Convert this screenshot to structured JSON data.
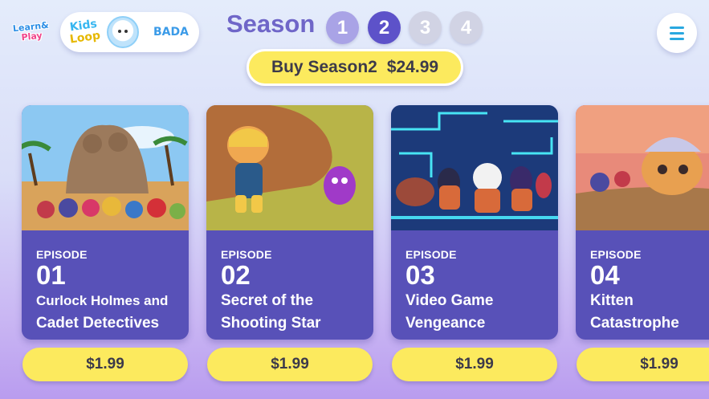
{
  "logo": {
    "line1": "Learn&",
    "line2": "Play"
  },
  "profile": {
    "brand_line1": "Kids",
    "brand_line2": "Loop",
    "name": "BADA"
  },
  "season": {
    "label": "Season",
    "numbers": [
      "1",
      "2",
      "3",
      "4"
    ],
    "selected": "2"
  },
  "buy": {
    "label": "Buy Season2",
    "price": "$24.99"
  },
  "menu": {
    "icon": "hamburger-menu-icon"
  },
  "episodes": [
    {
      "label": "EPISODE",
      "number": "01",
      "title_line1": "Curlock Holmes and",
      "title_line2": "Cadet Detectives",
      "price": "$1.99"
    },
    {
      "label": "EPISODE",
      "number": "02",
      "title_line1": "Secret of the",
      "title_line2": "Shooting Star",
      "price": "$1.99"
    },
    {
      "label": "EPISODE",
      "number": "03",
      "title_line1": "Video Game",
      "title_line2": "Vengeance",
      "price": "$1.99"
    },
    {
      "label": "EPISODE",
      "number": "04",
      "title_line1": "Kitten",
      "title_line2": "Catastrophe",
      "price": "$1.99"
    }
  ],
  "colors": {
    "card": "#5851b8",
    "price_button": "#fcea5e",
    "season_selected": "#5d52c9",
    "season_title": "#6f66c8"
  }
}
